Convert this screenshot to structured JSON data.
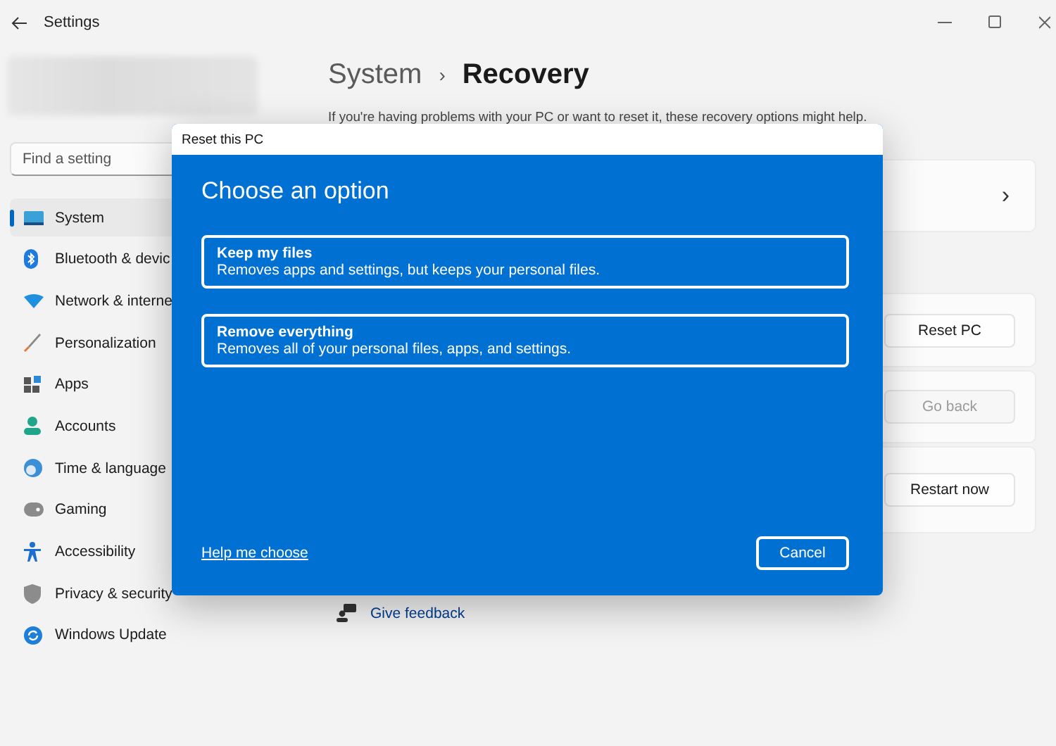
{
  "window": {
    "title": "Settings"
  },
  "search": {
    "placeholder": "Find a setting"
  },
  "sidebar": {
    "items": [
      {
        "label": "System",
        "selected": true
      },
      {
        "label": "Bluetooth & devic",
        "selected": false
      },
      {
        "label": "Network & interne",
        "selected": false
      },
      {
        "label": "Personalization",
        "selected": false
      },
      {
        "label": "Apps",
        "selected": false
      },
      {
        "label": "Accounts",
        "selected": false
      },
      {
        "label": "Time & language",
        "selected": false
      },
      {
        "label": "Gaming",
        "selected": false
      },
      {
        "label": "Accessibility",
        "selected": false
      },
      {
        "label": "Privacy & security",
        "selected": false
      },
      {
        "label": "Windows Update",
        "selected": false
      }
    ]
  },
  "breadcrumb": {
    "parent": "System",
    "separator": "›",
    "current": "Recovery"
  },
  "description": "If you're having problems with your PC or want to reset it, these recovery options might help.",
  "cards": [
    {
      "kind": "chevron",
      "text": "›"
    },
    {
      "kind": "button",
      "button": "Reset PC",
      "disabled": false
    },
    {
      "kind": "button",
      "button": "Go back",
      "disabled": true
    },
    {
      "kind": "button",
      "button": "Restart now",
      "disabled": false
    }
  ],
  "feedback": "Give feedback",
  "dialog": {
    "title": "Reset this PC",
    "heading": "Choose an option",
    "options": [
      {
        "title": "Keep my files",
        "subtitle": "Removes apps and settings, but keeps your personal files."
      },
      {
        "title": "Remove everything",
        "subtitle": "Removes all of your personal files, apps, and settings."
      }
    ],
    "help_link": "Help me choose",
    "cancel": "Cancel"
  }
}
